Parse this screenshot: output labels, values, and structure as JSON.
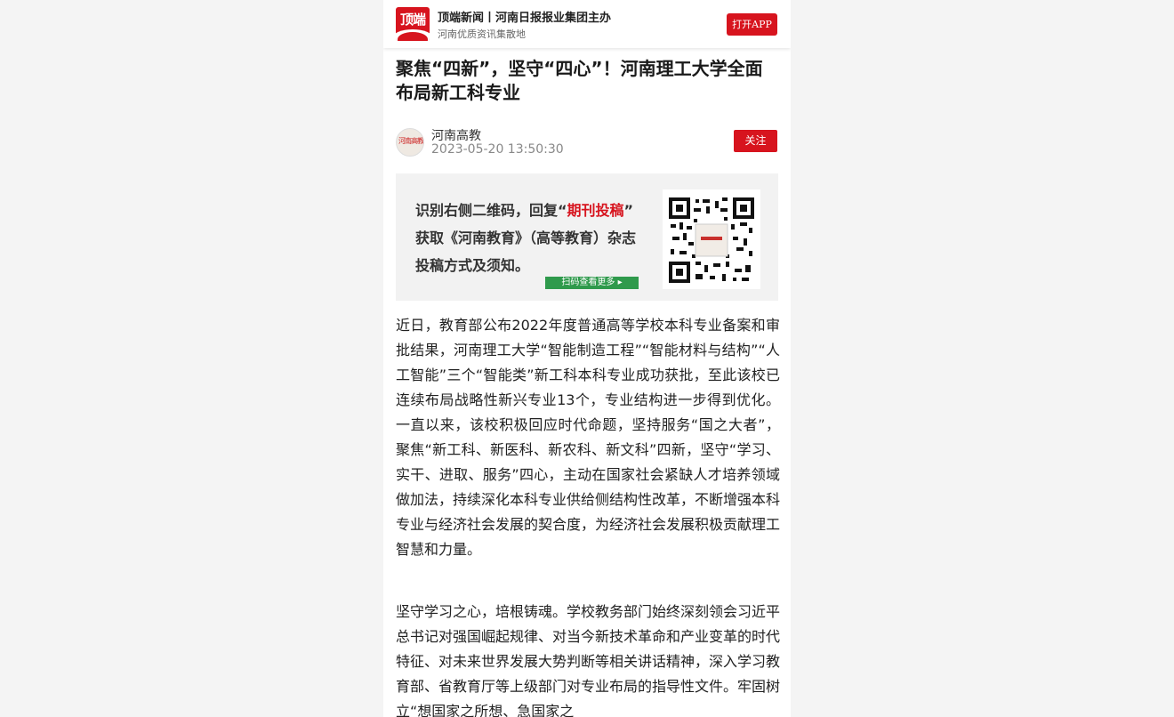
{
  "header": {
    "logo_text": "顶端",
    "brand_title": "顶端新闻丨河南日报报业集团主办",
    "brand_subtitle": "河南优质资讯集散地",
    "open_app_label": "打开APP"
  },
  "article": {
    "title": "聚焦“四新”，坚守“四心”！河南理工大学全面布局新工科专业",
    "author": "河南高教",
    "date": "2023-05-20 13:50:30",
    "follow_label": "关注",
    "paragraphs": [
      "近日，教育部公布2022年度普通高等学校本科专业备案和审批结果，河南理工大学“智能制造工程”“智能材料与结构”“人工智能”三个“智能类”新工科本科专业成功获批，至此该校已连续布局战略性新兴专业13个，专业结构进一步得到优化。一直以来，该校积极回应时代命题，坚持服务“国之大者”，聚焦“新工科、新医科、新农科、新文科”四新，坚守“学习、实干、进取、服务”四心，主动在国家社会紧缺人才培养领域做加法，持续深化本科专业供给侧结构性改革，不断增强本科专业与经济社会发展的契合度，为经济社会发展积极贡献理工智慧和力量。",
      "坚守学习之心，培根铸魂。学校教务部门始终深刻领会习近平总书记对强国崛起规律、对当今新技术革命和产业变革的时代特征、对未来世界发展大势判断等相关讲话精神，深入学习教育部、省教育厅等上级部门对专业布局的指导性文件。牢固树立“想国家之所想、急国家之"
    ]
  },
  "banner": {
    "line1_prefix": "识别右侧二维码，回复“",
    "line1_highlight": "期刊投稿",
    "line1_suffix": "”",
    "line2": "获取《河南教育》（高等教育）杂志",
    "line3": "投稿方式及须知。",
    "scan_label": "扫码查看更多 ▸",
    "qr_icon": "qr-code"
  },
  "colors": {
    "accent": "#d7141e",
    "scan_green": "#2f9a4c",
    "background": "#f4f4f4"
  }
}
